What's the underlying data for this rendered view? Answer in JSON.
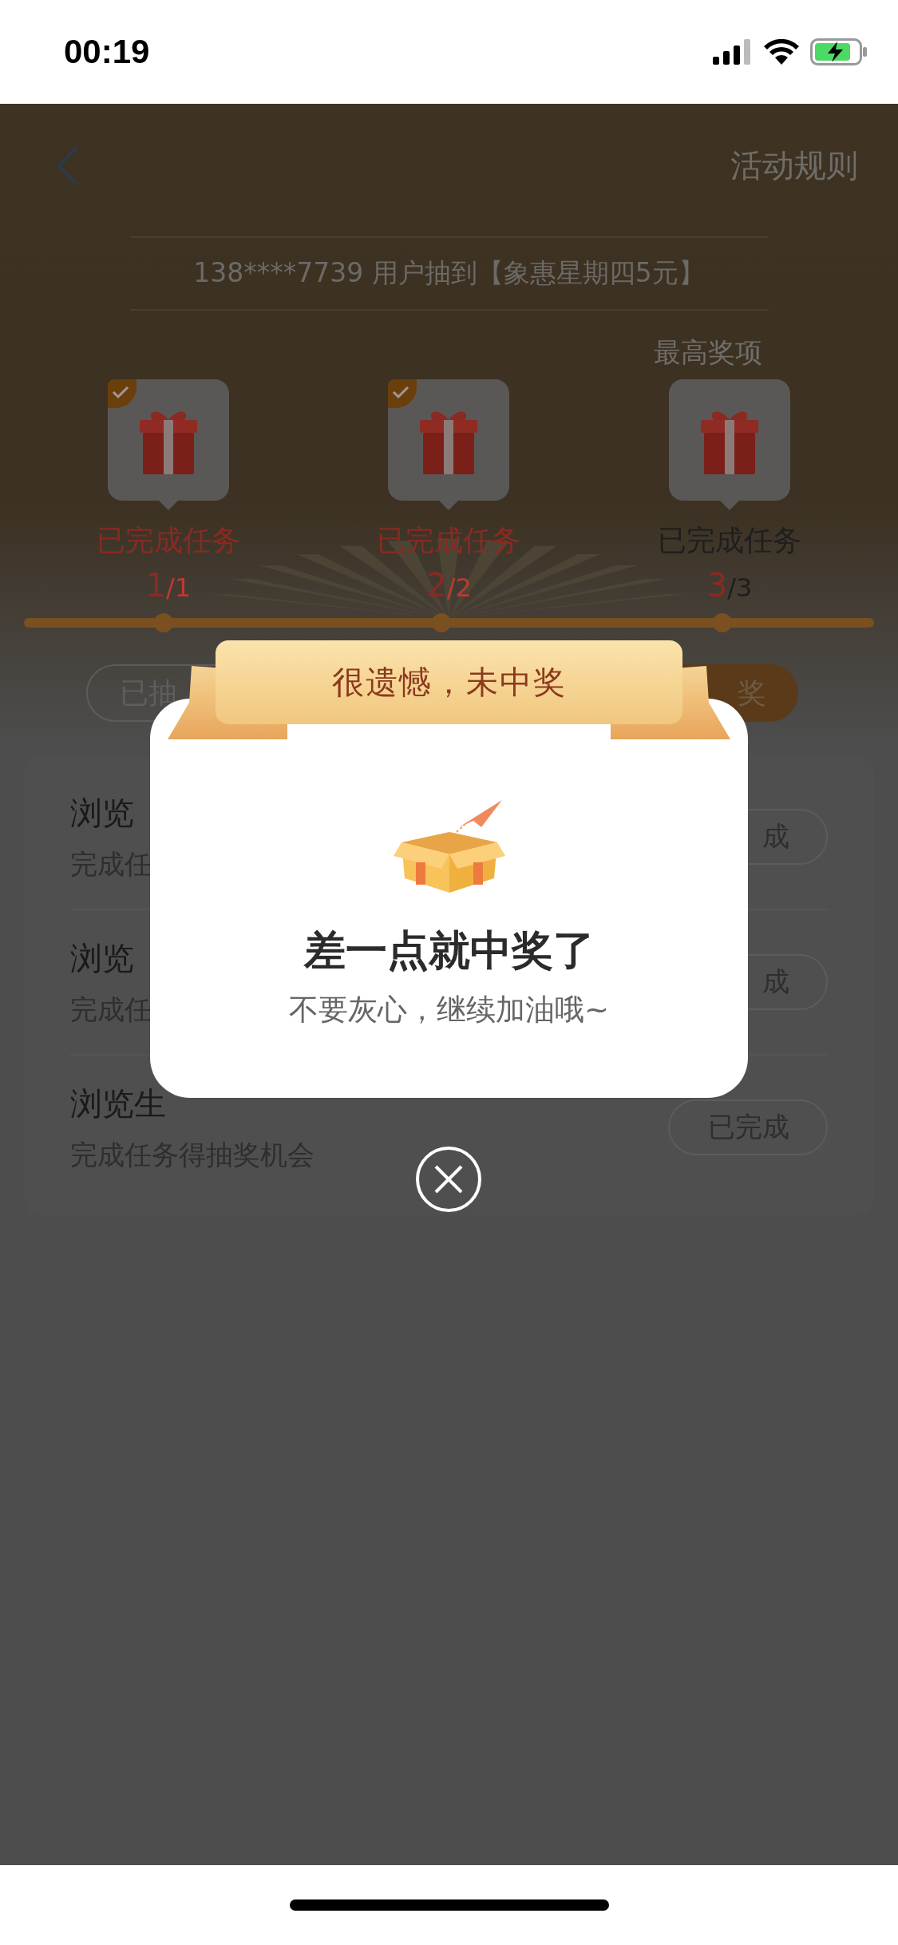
{
  "status_bar": {
    "time": "00:19"
  },
  "nav": {
    "rules_link": "活动规则"
  },
  "ticker": "138****7739 用户抽到【象惠星期四5元】",
  "top_prize_label": "最高奖项",
  "milestones": [
    {
      "done": true,
      "label": "已完成任务",
      "current": "1",
      "total": "/1"
    },
    {
      "done": true,
      "label": "已完成任务",
      "current": "2",
      "total": "/2"
    },
    {
      "done": false,
      "label": "已完成任务",
      "current": "3",
      "total": "/3"
    }
  ],
  "buttons": [
    {
      "label": "已抽",
      "kind": "outline"
    },
    {
      "label": "奖",
      "kind": "filled"
    }
  ],
  "tasks": [
    {
      "title": "浏览",
      "desc": "完成任",
      "action": "成"
    },
    {
      "title": "浏览",
      "desc": "完成任",
      "action": "成"
    },
    {
      "title": "浏览生",
      "desc": "完成任务得抽奖机会",
      "action": "已完成"
    }
  ],
  "dialog": {
    "banner": "很遗憾，未中奖",
    "title": "差一点就中奖了",
    "message": "不要灰心，继续加油哦~"
  }
}
